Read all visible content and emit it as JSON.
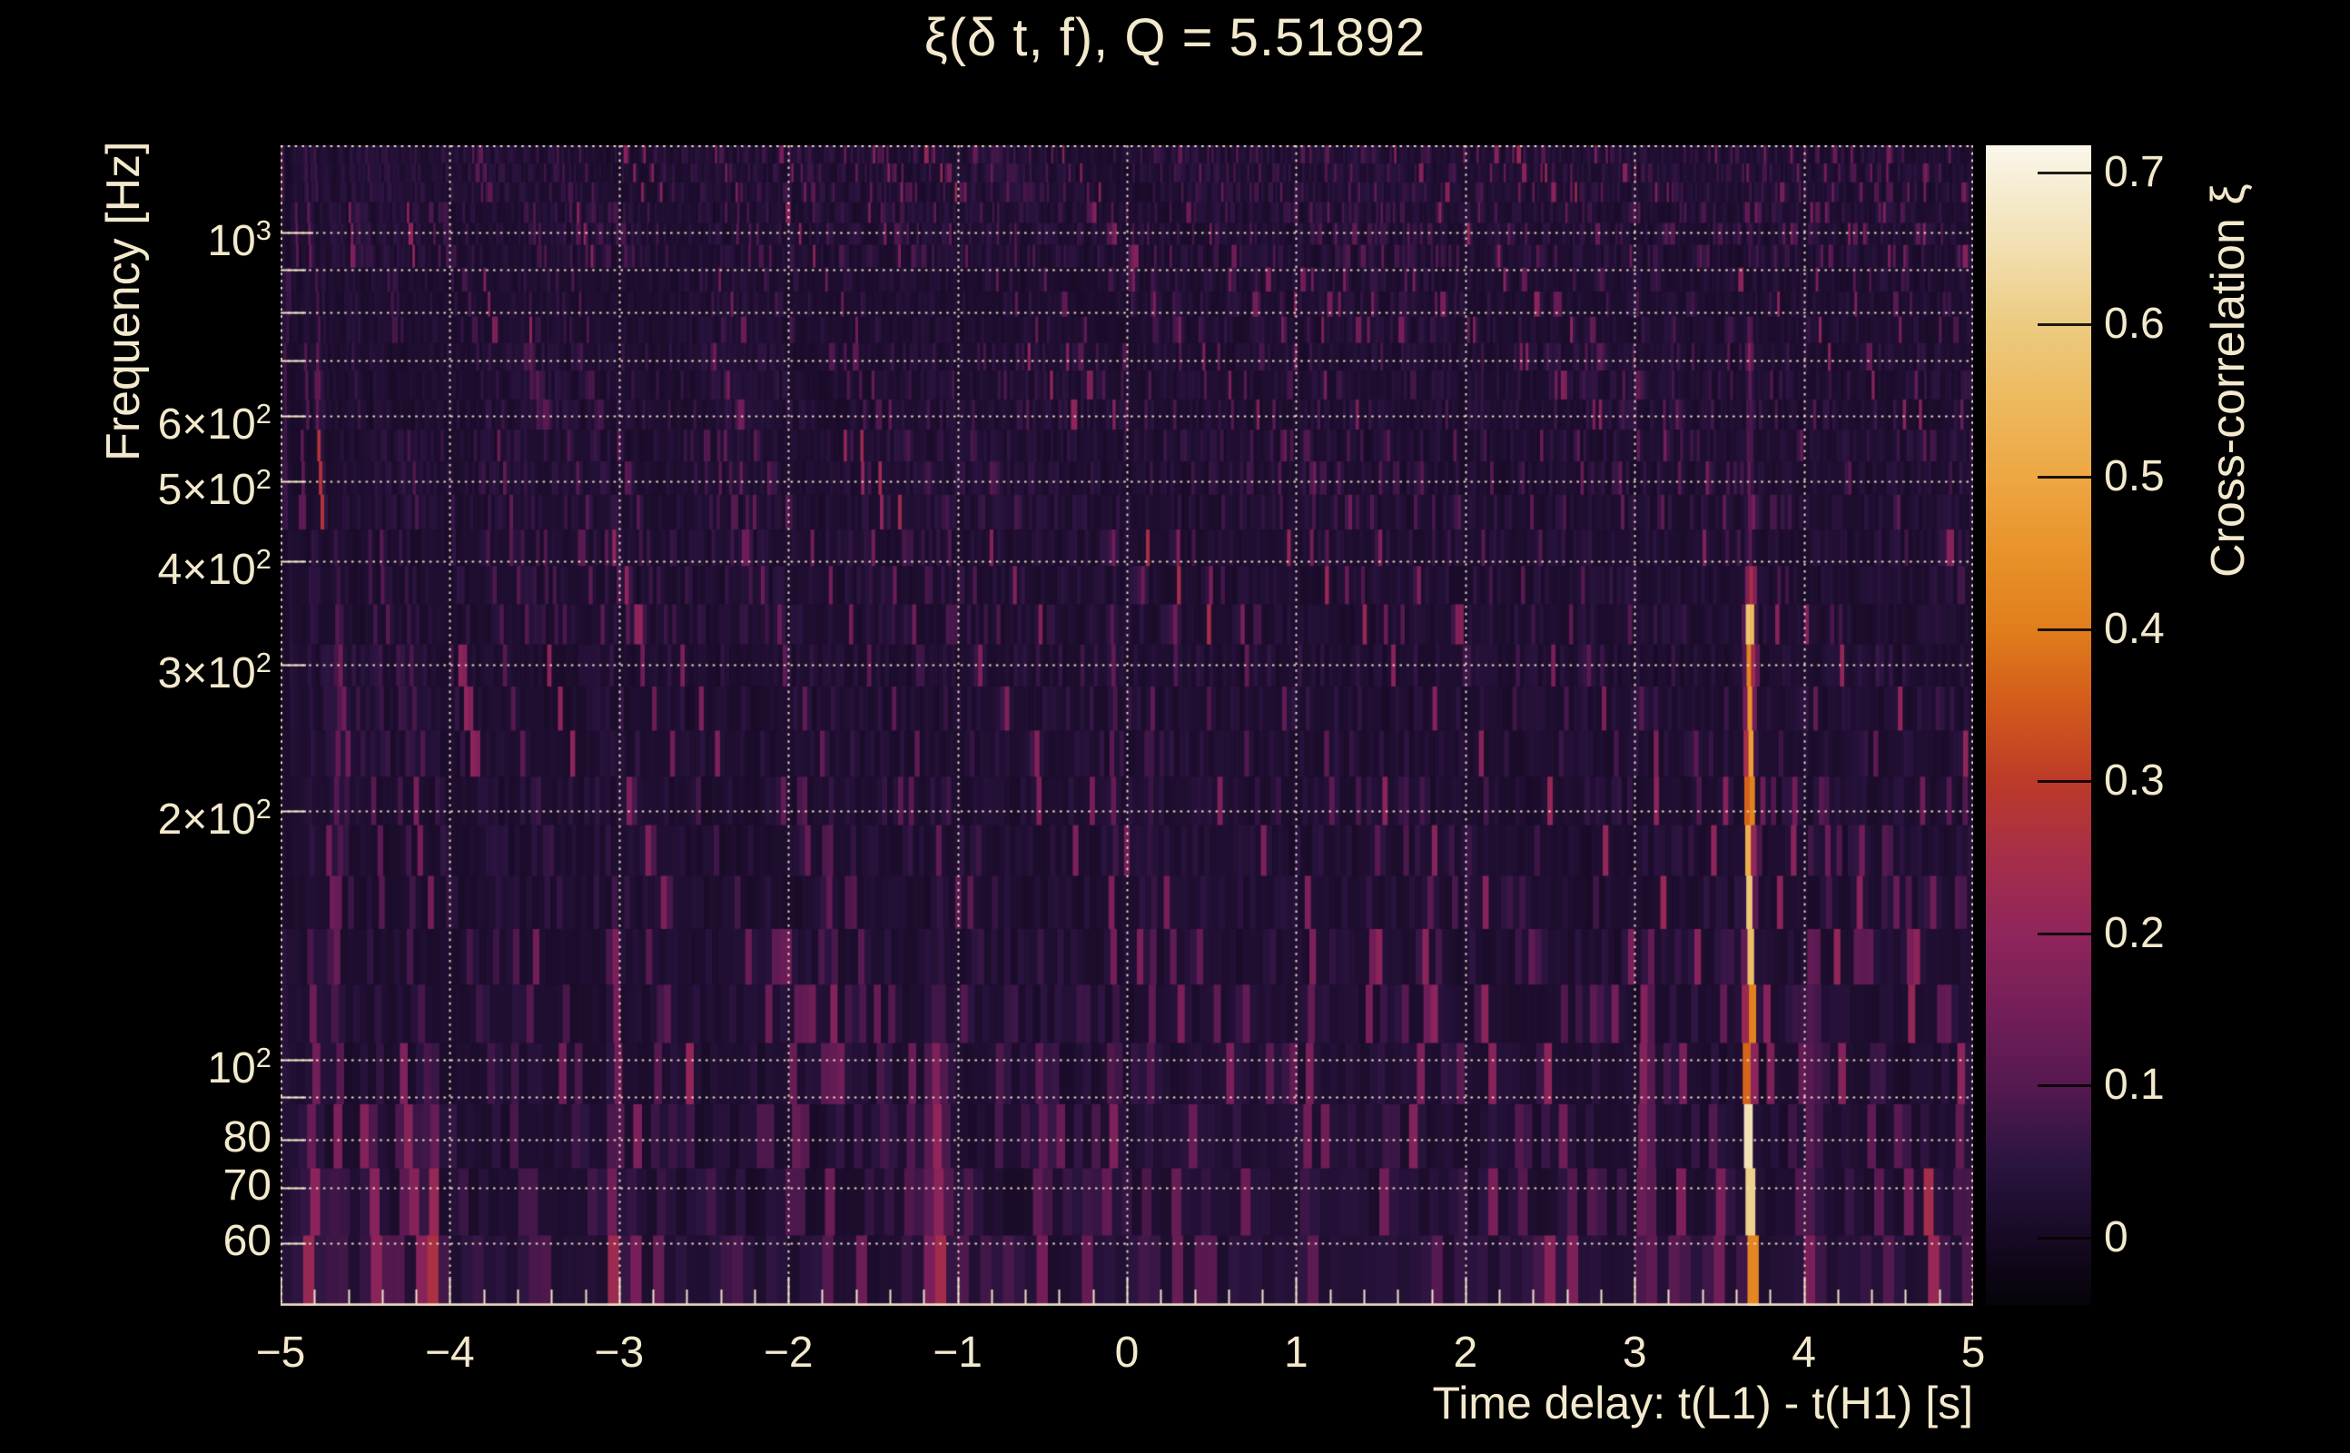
{
  "page": {
    "background_color": "#000000",
    "text_color": "#f3e9cc",
    "grid_color": "#efe3c6"
  },
  "chart_data": {
    "type": "heatmap",
    "title": "ξ(δ t, f), Q = 5.51892",
    "xlabel": "Time delay: t(L1) - t(H1) [s]",
    "ylabel": "Frequency [Hz]",
    "zlabel": "Cross-correlation ξ",
    "x_range": [
      -5,
      5
    ],
    "x_minor_tick_step": 0.2,
    "y_scale": "log",
    "y_range_hz": [
      50.4,
      1274
    ],
    "z_range": [
      -0.044,
      0.718
    ],
    "grid": "dotted cream lines at integer time delays and decade-multiple frequencies; solid bottom axis with inward ticks",
    "legend_position": "right colorbar",
    "x_ticks": [
      {
        "v": -5,
        "label": "−5"
      },
      {
        "v": -4,
        "label": "−4"
      },
      {
        "v": -3,
        "label": "−3"
      },
      {
        "v": -2,
        "label": "−2"
      },
      {
        "v": -1,
        "label": "−1"
      },
      {
        "v": 0,
        "label": "0"
      },
      {
        "v": 1,
        "label": "1"
      },
      {
        "v": 2,
        "label": "2"
      },
      {
        "v": 3,
        "label": "3"
      },
      {
        "v": 4,
        "label": "4"
      },
      {
        "v": 5,
        "label": "5"
      }
    ],
    "y_ticks": [
      {
        "f": 1000,
        "base": "10",
        "exp": "3"
      },
      {
        "f": 600,
        "base": "6×10",
        "exp": "2"
      },
      {
        "f": 500,
        "base": "5×10",
        "exp": "2"
      },
      {
        "f": 400,
        "base": "4×10",
        "exp": "2"
      },
      {
        "f": 300,
        "base": "3×10",
        "exp": "2"
      },
      {
        "f": 200,
        "base": "2×10",
        "exp": "2"
      },
      {
        "f": 100,
        "base": "10",
        "exp": "2"
      },
      {
        "f": 80,
        "base": "80",
        "exp": ""
      },
      {
        "f": 70,
        "base": "70",
        "exp": ""
      },
      {
        "f": 60,
        "base": "60",
        "exp": ""
      }
    ],
    "y_gridlines_hz": [
      1000,
      900,
      800,
      700,
      600,
      500,
      400,
      300,
      200,
      100,
      90,
      80,
      70,
      60
    ],
    "x_gridlines": [
      -4,
      -3,
      -2,
      -1,
      0,
      1,
      2,
      3,
      4
    ],
    "z_ticks": [
      {
        "v": 0.7,
        "label": "0.7"
      },
      {
        "v": 0.6,
        "label": "0.6"
      },
      {
        "v": 0.5,
        "label": "0.5"
      },
      {
        "v": 0.4,
        "label": "0.4"
      },
      {
        "v": 0.3,
        "label": "0.3"
      },
      {
        "v": 0.2,
        "label": "0.2"
      },
      {
        "v": 0.1,
        "label": "0.1"
      },
      {
        "v": 0,
        "label": "0"
      }
    ],
    "colormap_stops": [
      {
        "v": -0.044,
        "color": "#060309"
      },
      {
        "v": 0.0,
        "color": "#160a24"
      },
      {
        "v": 0.05,
        "color": "#2b1440"
      },
      {
        "v": 0.1,
        "color": "#551950"
      },
      {
        "v": 0.15,
        "color": "#751e59"
      },
      {
        "v": 0.2,
        "color": "#8f255b"
      },
      {
        "v": 0.25,
        "color": "#a62e49"
      },
      {
        "v": 0.3,
        "color": "#bc3a28"
      },
      {
        "v": 0.35,
        "color": "#d25a1c"
      },
      {
        "v": 0.4,
        "color": "#e07e1c"
      },
      {
        "v": 0.45,
        "color": "#e9922a"
      },
      {
        "v": 0.5,
        "color": "#eda743"
      },
      {
        "v": 0.55,
        "color": "#edb95e"
      },
      {
        "v": 0.6,
        "color": "#eccb80"
      },
      {
        "v": 0.65,
        "color": "#f2dfb0"
      },
      {
        "v": 0.7,
        "color": "#f7f0da"
      },
      {
        "v": 0.718,
        "color": "#fbf7ec"
      }
    ],
    "notable_streaks": [
      {
        "t": 3.68,
        "f_top": 330,
        "peak": 0.74,
        "width": 0.018
      },
      {
        "t": 3.68,
        "f_top": 700,
        "peak": 0.17,
        "width": 0.016
      },
      {
        "t": 3.07,
        "f_top": 115,
        "peak": 0.33,
        "width": 0.022
      },
      {
        "t": 4.75,
        "f_top": 64,
        "peak": 0.42,
        "width": 0.018
      },
      {
        "t": 4.94,
        "f_top": 95,
        "peak": 0.24,
        "width": 0.02
      },
      {
        "t": 4.06,
        "f_top": 125,
        "peak": 0.24,
        "width": 0.02
      },
      {
        "t": -3.02,
        "f_top": 135,
        "peak": 0.27,
        "width": 0.02
      },
      {
        "t": -1.12,
        "f_top": 100,
        "peak": 0.26,
        "width": 0.045
      },
      {
        "t": -4.8,
        "f_top": 105,
        "peak": 0.24,
        "width": 0.02
      },
      {
        "t": -4.66,
        "f_top": 310,
        "peak": 0.17,
        "width": 0.015
      },
      {
        "t": -4.28,
        "f_top": 95,
        "peak": 0.17,
        "width": 0.02
      },
      {
        "t": -4.1,
        "f_top": 85,
        "peak": 0.26,
        "width": 0.018
      },
      {
        "t": 1.08,
        "f_top": 105,
        "peak": 0.22,
        "width": 0.02
      },
      {
        "t": -0.08,
        "f_top": 310,
        "peak": 0.2,
        "width": 0.012
      },
      {
        "t": 0.15,
        "f_top": 260,
        "peak": 0.13,
        "width": 0.015
      },
      {
        "t": -2.9,
        "f_top": 80,
        "peak": 0.17,
        "width": 0.02
      },
      {
        "t": -2.77,
        "f_top": 105,
        "peak": 0.14,
        "width": 0.018
      },
      {
        "t": -0.5,
        "f_top": 95,
        "peak": 0.16,
        "width": 0.02
      },
      {
        "t": 2.62,
        "f_top": 70,
        "peak": 0.18,
        "width": 0.02
      },
      {
        "t": 0.3,
        "f_top": 65,
        "peak": 0.15,
        "width": 0.02
      }
    ],
    "background_texture": {
      "seed": 7,
      "base": 0.006,
      "streak_scale": 0.02,
      "hot_fraction_top": 0.025,
      "hot_fraction_bottom": 0.085,
      "hot_boost": 0.12,
      "description": "dense faint vertical purple striations over near-black background, streaks wider and brighter toward low frequencies"
    }
  }
}
